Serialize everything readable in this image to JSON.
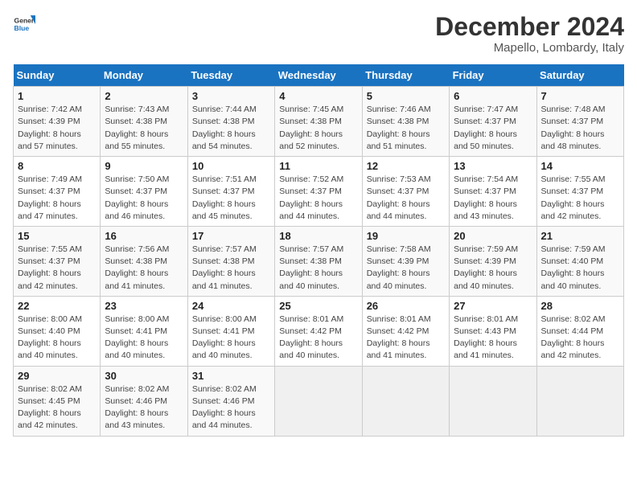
{
  "header": {
    "logo_line1": "General",
    "logo_line2": "Blue",
    "month_title": "December 2024",
    "location": "Mapello, Lombardy, Italy"
  },
  "weekdays": [
    "Sunday",
    "Monday",
    "Tuesday",
    "Wednesday",
    "Thursday",
    "Friday",
    "Saturday"
  ],
  "weeks": [
    [
      {
        "day": "1",
        "sunrise": "7:42 AM",
        "sunset": "4:39 PM",
        "daylight": "8 hours and 57 minutes."
      },
      {
        "day": "2",
        "sunrise": "7:43 AM",
        "sunset": "4:38 PM",
        "daylight": "8 hours and 55 minutes."
      },
      {
        "day": "3",
        "sunrise": "7:44 AM",
        "sunset": "4:38 PM",
        "daylight": "8 hours and 54 minutes."
      },
      {
        "day": "4",
        "sunrise": "7:45 AM",
        "sunset": "4:38 PM",
        "daylight": "8 hours and 52 minutes."
      },
      {
        "day": "5",
        "sunrise": "7:46 AM",
        "sunset": "4:38 PM",
        "daylight": "8 hours and 51 minutes."
      },
      {
        "day": "6",
        "sunrise": "7:47 AM",
        "sunset": "4:37 PM",
        "daylight": "8 hours and 50 minutes."
      },
      {
        "day": "7",
        "sunrise": "7:48 AM",
        "sunset": "4:37 PM",
        "daylight": "8 hours and 48 minutes."
      }
    ],
    [
      {
        "day": "8",
        "sunrise": "7:49 AM",
        "sunset": "4:37 PM",
        "daylight": "8 hours and 47 minutes."
      },
      {
        "day": "9",
        "sunrise": "7:50 AM",
        "sunset": "4:37 PM",
        "daylight": "8 hours and 46 minutes."
      },
      {
        "day": "10",
        "sunrise": "7:51 AM",
        "sunset": "4:37 PM",
        "daylight": "8 hours and 45 minutes."
      },
      {
        "day": "11",
        "sunrise": "7:52 AM",
        "sunset": "4:37 PM",
        "daylight": "8 hours and 44 minutes."
      },
      {
        "day": "12",
        "sunrise": "7:53 AM",
        "sunset": "4:37 PM",
        "daylight": "8 hours and 44 minutes."
      },
      {
        "day": "13",
        "sunrise": "7:54 AM",
        "sunset": "4:37 PM",
        "daylight": "8 hours and 43 minutes."
      },
      {
        "day": "14",
        "sunrise": "7:55 AM",
        "sunset": "4:37 PM",
        "daylight": "8 hours and 42 minutes."
      }
    ],
    [
      {
        "day": "15",
        "sunrise": "7:55 AM",
        "sunset": "4:37 PM",
        "daylight": "8 hours and 42 minutes."
      },
      {
        "day": "16",
        "sunrise": "7:56 AM",
        "sunset": "4:38 PM",
        "daylight": "8 hours and 41 minutes."
      },
      {
        "day": "17",
        "sunrise": "7:57 AM",
        "sunset": "4:38 PM",
        "daylight": "8 hours and 41 minutes."
      },
      {
        "day": "18",
        "sunrise": "7:57 AM",
        "sunset": "4:38 PM",
        "daylight": "8 hours and 40 minutes."
      },
      {
        "day": "19",
        "sunrise": "7:58 AM",
        "sunset": "4:39 PM",
        "daylight": "8 hours and 40 minutes."
      },
      {
        "day": "20",
        "sunrise": "7:59 AM",
        "sunset": "4:39 PM",
        "daylight": "8 hours and 40 minutes."
      },
      {
        "day": "21",
        "sunrise": "7:59 AM",
        "sunset": "4:40 PM",
        "daylight": "8 hours and 40 minutes."
      }
    ],
    [
      {
        "day": "22",
        "sunrise": "8:00 AM",
        "sunset": "4:40 PM",
        "daylight": "8 hours and 40 minutes."
      },
      {
        "day": "23",
        "sunrise": "8:00 AM",
        "sunset": "4:41 PM",
        "daylight": "8 hours and 40 minutes."
      },
      {
        "day": "24",
        "sunrise": "8:00 AM",
        "sunset": "4:41 PM",
        "daylight": "8 hours and 40 minutes."
      },
      {
        "day": "25",
        "sunrise": "8:01 AM",
        "sunset": "4:42 PM",
        "daylight": "8 hours and 40 minutes."
      },
      {
        "day": "26",
        "sunrise": "8:01 AM",
        "sunset": "4:42 PM",
        "daylight": "8 hours and 41 minutes."
      },
      {
        "day": "27",
        "sunrise": "8:01 AM",
        "sunset": "4:43 PM",
        "daylight": "8 hours and 41 minutes."
      },
      {
        "day": "28",
        "sunrise": "8:02 AM",
        "sunset": "4:44 PM",
        "daylight": "8 hours and 42 minutes."
      }
    ],
    [
      {
        "day": "29",
        "sunrise": "8:02 AM",
        "sunset": "4:45 PM",
        "daylight": "8 hours and 42 minutes."
      },
      {
        "day": "30",
        "sunrise": "8:02 AM",
        "sunset": "4:46 PM",
        "daylight": "8 hours and 43 minutes."
      },
      {
        "day": "31",
        "sunrise": "8:02 AM",
        "sunset": "4:46 PM",
        "daylight": "8 hours and 44 minutes."
      },
      null,
      null,
      null,
      null
    ]
  ]
}
